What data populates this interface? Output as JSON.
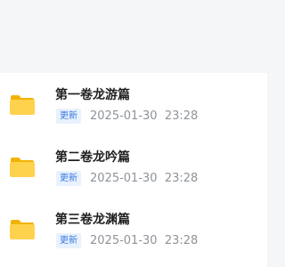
{
  "folders": [
    {
      "title": "第一卷龙游篇",
      "badge": "更新",
      "date": "2025-01-30",
      "time": "23:28",
      "icon": "folder-icon"
    },
    {
      "title": "第二卷龙吟篇",
      "badge": "更新",
      "date": "2025-01-30",
      "time": "23:28",
      "icon": "folder-icon"
    },
    {
      "title": "第三卷龙渊篇",
      "badge": "更新",
      "date": "2025-01-30",
      "time": "23:28",
      "icon": "folder-icon"
    }
  ],
  "colors": {
    "folder_back": "#f2b300",
    "folder_front": "#ffd24d",
    "badge_text": "#3a7ae0",
    "badge_bg": "#e8f1fd",
    "time_text": "#8e9399",
    "title_text": "#1f1f1f"
  }
}
